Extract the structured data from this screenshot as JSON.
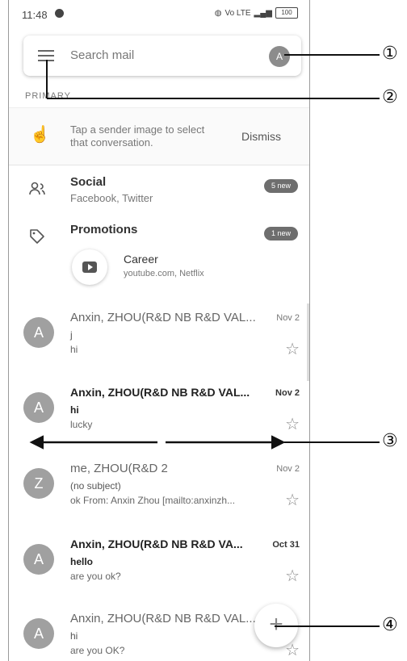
{
  "status_bar": {
    "time": "11:48",
    "signal_text": "Vo LTE",
    "battery": "100"
  },
  "search": {
    "placeholder": "Search mail",
    "avatar_letter": "A"
  },
  "section_label": "PRIMARY",
  "tip": {
    "text": "Tap a sender image to select that conversation.",
    "dismiss_label": "Dismiss"
  },
  "categories": [
    {
      "title": "Social",
      "subtitle": "Facebook, Twitter",
      "badge": "5 new"
    },
    {
      "title": "Promotions",
      "badge": "1 new"
    }
  ],
  "promo_item": {
    "title": "Career",
    "subtitle": "youtube.com, Netflix"
  },
  "emails": [
    {
      "avatar": "A",
      "sender": "Anxin, ZHOU(R&D NB R&D VAL...",
      "date": "Nov 2",
      "subject": "j",
      "snippet": "hi",
      "unread": false
    },
    {
      "avatar": "A",
      "sender": "Anxin, ZHOU(R&D NB R&D VAL...",
      "date": "Nov 2",
      "subject": "hi",
      "snippet": "lucky",
      "unread": true
    },
    {
      "avatar": "Z",
      "sender": "me, ZHOU(R&D  2",
      "date": "Nov 2",
      "subject": "(no subject)",
      "snippet": "ok From: Anxin Zhou [mailto:anxinzh...",
      "unread": false
    },
    {
      "avatar": "A",
      "sender": "Anxin, ZHOU(R&D NB R&D VA...",
      "date": "Oct 31",
      "subject": "hello",
      "snippet": "are you ok?",
      "unread": true
    },
    {
      "avatar": "A",
      "sender": "Anxin, ZHOU(R&D NB R&D VAL...",
      "date": "",
      "subject": "hi",
      "snippet": "are you OK?",
      "unread": false
    }
  ],
  "fab": {
    "symbol": "+"
  },
  "callouts": [
    "①",
    "②",
    "③",
    "④"
  ]
}
